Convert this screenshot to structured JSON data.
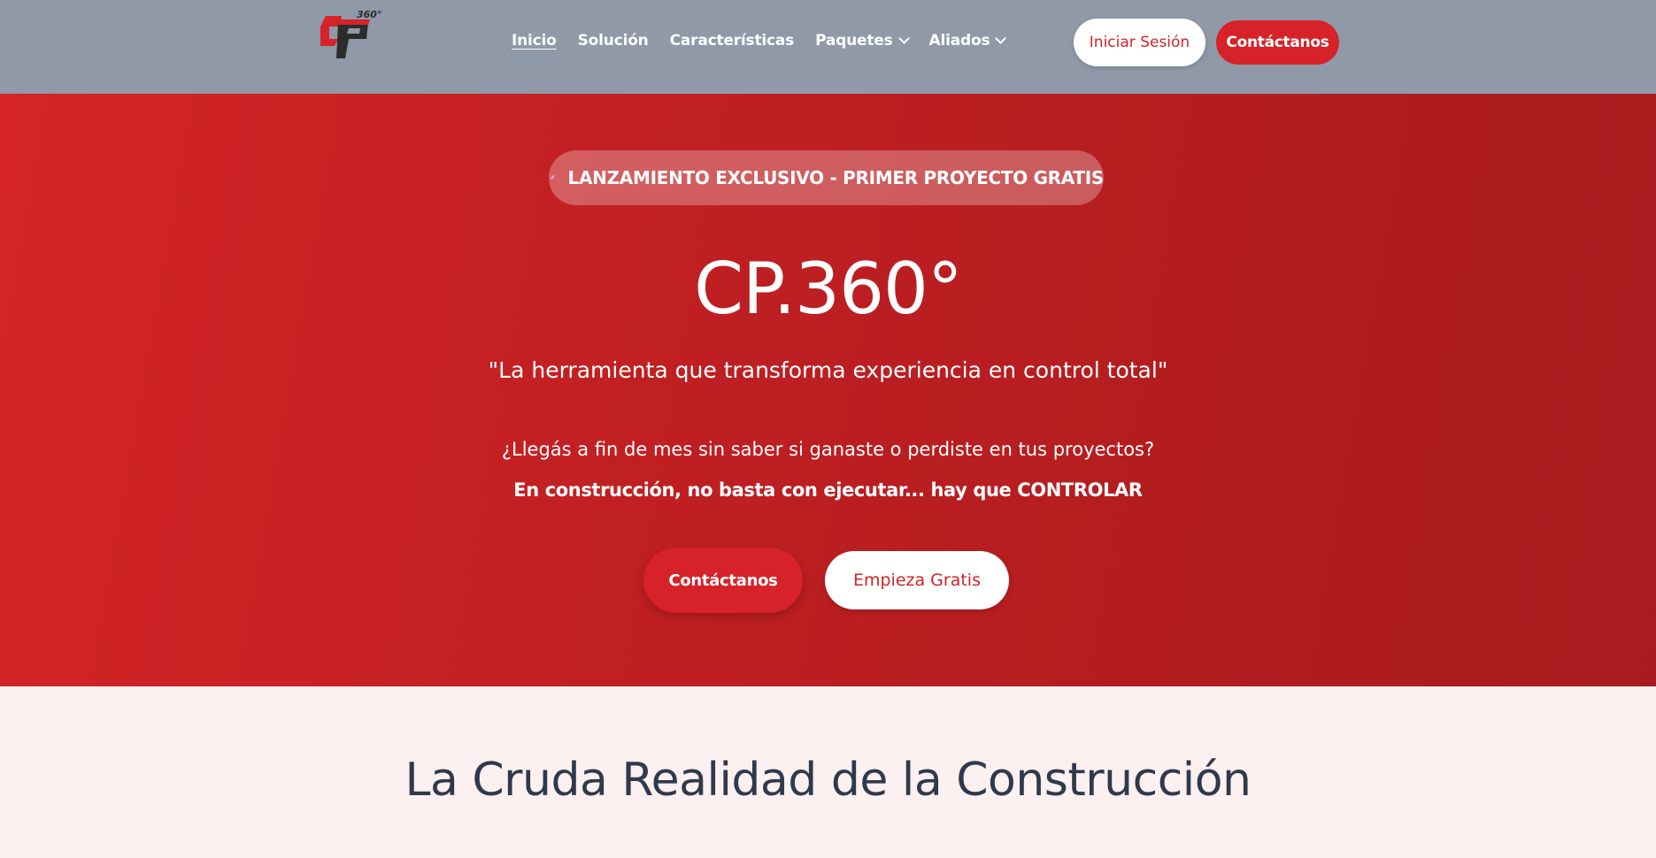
{
  "brand": {
    "logo_text": "CP",
    "logo_superscript": "360°",
    "colors": {
      "primary": "#d62228",
      "nav_bg": "#8f99a8",
      "section_bg": "#fdf0f1",
      "heading": "#2e3a4b"
    }
  },
  "nav": {
    "links": [
      {
        "label": "Inicio",
        "active": true,
        "dropdown": false
      },
      {
        "label": "Solución",
        "active": false,
        "dropdown": false
      },
      {
        "label": "Características",
        "active": false,
        "dropdown": false
      },
      {
        "label": "Paquetes",
        "active": false,
        "dropdown": true
      },
      {
        "label": "Aliados",
        "active": false,
        "dropdown": true
      }
    ],
    "login_label": "Iniciar Sesión",
    "contact_label": "Contáctanos"
  },
  "hero": {
    "badge_icon": "rocket-icon",
    "badge_text": "LANZAMIENTO EXCLUSIVO - PRIMER PROYECTO GRATIS",
    "title": "CP.360°",
    "subtitle": "\"La herramienta que transforma experiencia en control total\"",
    "question": "¿Llegás a fin de mes sin saber si ganaste o perdiste en tus proyectos?",
    "emphasis": "En construcción, no basta con ejecutar... hay que CONTROLAR",
    "cta_contact": "Contáctanos",
    "cta_free": "Empieza Gratis"
  },
  "section": {
    "title": "La Cruda Realidad de la Construcción"
  }
}
